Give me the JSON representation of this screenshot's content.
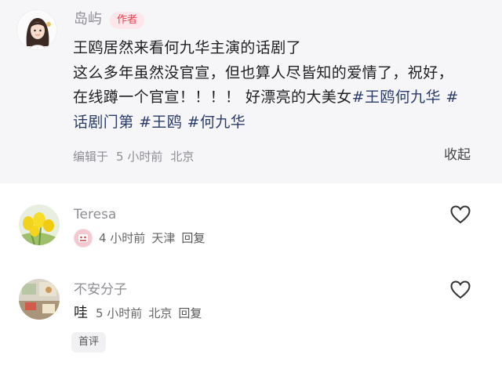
{
  "post": {
    "author_name": "岛屿",
    "author_badge": "作者",
    "lines": [
      "王鸥居然来看何九华主演的话剧了",
      "这么多年虽然没官宣，但也算人尽皆知的爱情了，祝好，",
      "在线蹲一个官宣！！！！ 好漂亮的大美女"
    ],
    "tags": [
      "#王鸥何九华",
      "#话剧门第",
      "#王鸥",
      "#何九华"
    ],
    "meta": {
      "edited": "编辑于",
      "time": "5 小时前",
      "location": "北京"
    },
    "collapse_label": "收起"
  },
  "comments": [
    {
      "name": "Teresa",
      "time": "4 小时前",
      "location": "天津",
      "reply_label": "回复",
      "avatar": "yellow-tulips",
      "sticker": "emoji-sticker"
    },
    {
      "name": "不安分子",
      "text": "哇",
      "time": "5 小时前",
      "location": "北京",
      "reply_label": "回复",
      "badge": "首评",
      "avatar": "room-photo"
    }
  ],
  "icons": {
    "like": "heart-outline-icon"
  },
  "colors": {
    "tag": "#2b3c6b",
    "badge_bg": "#fde7ea",
    "badge_text": "#e8414d",
    "post_bg": "#f6f6f8"
  }
}
